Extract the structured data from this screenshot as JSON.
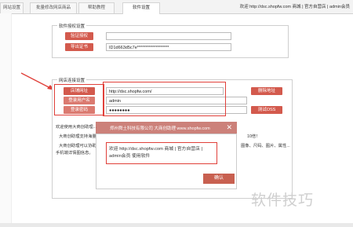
{
  "tabs": [
    {
      "label": "网站设置"
    },
    {
      "label": "批量修改网店商品"
    },
    {
      "label": "帮助教程"
    },
    {
      "label": "软件设置"
    }
  ],
  "header": {
    "welcome": "欢迎 http://dsc.shopfw.com 商城 | 官方自营店 | admin会员"
  },
  "license": {
    "legend": "软件授权设置",
    "verify_button": "验证授权",
    "export_button": "导出证书",
    "license_id": "ID1d663d5c7e*******************"
  },
  "connection": {
    "legend": "网店连接设置",
    "site_url_button": "店铺网址",
    "site_url_value": "http://dsc.shopfw.com/",
    "username_button": "登录用户名",
    "username_value": "admin",
    "password_button": "登录密码",
    "password_value": "●●●●●●●●",
    "delete_url_button": "删除地址",
    "test_oss_button": "测试OSS"
  },
  "info": {
    "line1": "欢迎使用大商创助理...",
    "line2": "大商创助理支持海量...",
    "line2_tail": "10倍！",
    "line3": "大商创助理可以协助...",
    "line3_tail": "图像、尺码、图片、属性...",
    "line4": "手机端详情图信息。"
  },
  "dialog": {
    "title": "郑州舜土科技有限公司 大商创助理 www.shopfw.com",
    "message": "欢迎 http://dsc.shopfw.com 商城 | 官方自营店 | admin会员 使用软件",
    "ok_button": "确认"
  },
  "watermark": "软件技巧",
  "colors": {
    "accent": "#d35a4d",
    "highlight": "#e0403a",
    "dialog_title": "#b95046"
  }
}
